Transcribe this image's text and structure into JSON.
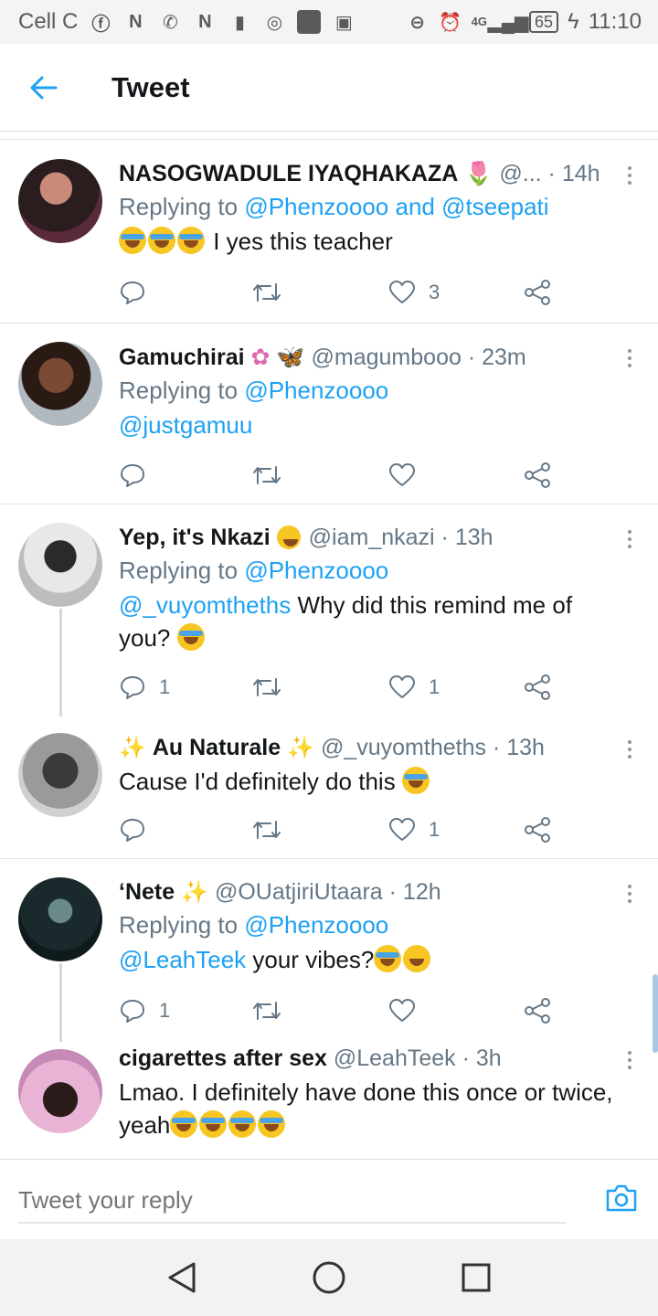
{
  "status_bar": {
    "carrier": "Cell C",
    "battery": "65",
    "network": "4G",
    "time": "11:10"
  },
  "header": {
    "title": "Tweet"
  },
  "tweets": [
    {
      "name": "NASOGWADULE IYAQHAKAZA",
      "handle": "@...",
      "time": "· 14h",
      "replying_prefix": "Replying to",
      "replying_to": "@Phenzoooo and @tseepati",
      "mention": "",
      "text": "I yes this teacher",
      "replies": "",
      "likes": "3",
      "avatar_color": "#3a2a2a"
    },
    {
      "name": "Gamuchirai",
      "handle": "@magumbooo",
      "time": "· 23m",
      "replying_prefix": "Replying to",
      "replying_to": "@Phenzoooo",
      "mention": "@justgamuu",
      "text": "",
      "replies": "",
      "likes": "",
      "avatar_color": "#6b4a3a"
    },
    {
      "name": "Yep, it's Nkazi",
      "handle": "@iam_nkazi",
      "time": "· 13h",
      "replying_prefix": "Replying to",
      "replying_to": "@Phenzoooo",
      "mention": "@_vuyomtheths",
      "text": "Why did this remind me of you?",
      "replies": "1",
      "likes": "1",
      "avatar_color": "#8a8a8a"
    },
    {
      "name": "Au Naturale",
      "handle": "@_vuyomtheths",
      "time": "· 13h",
      "replying_prefix": "",
      "replying_to": "",
      "mention": "",
      "text": "Cause I'd definitely do this",
      "replies": "",
      "likes": "1",
      "avatar_color": "#5a5a5a"
    },
    {
      "name": "‘Nete",
      "handle": "@OUatjiriUtaara",
      "time": "· 12h",
      "replying_prefix": "Replying to",
      "replying_to": "@Phenzoooo",
      "mention": "@LeahTeek",
      "text": "your vibes?",
      "replies": "1",
      "likes": "",
      "avatar_color": "#1c3b3a"
    },
    {
      "name": "cigarettes after sex",
      "handle": "@LeahTeek",
      "time": "· 3h",
      "replying_prefix": "",
      "replying_to": "",
      "mention": "",
      "text": "Lmao. I definitely have done this once or twice, yeah",
      "replies": "",
      "likes": "",
      "avatar_color": "#6a4a7a"
    }
  ],
  "reply_bar": {
    "placeholder": "Tweet your reply"
  },
  "icons": {
    "back": "arrow-left-icon",
    "reply": "reply-icon",
    "retweet": "retweet-icon",
    "like": "heart-icon",
    "share": "share-icon",
    "more": "more-vertical-icon",
    "camera": "camera-icon"
  },
  "colors": {
    "accent": "#1da1f2",
    "secondary_text": "#657786",
    "divider": "#dfe3e6"
  }
}
